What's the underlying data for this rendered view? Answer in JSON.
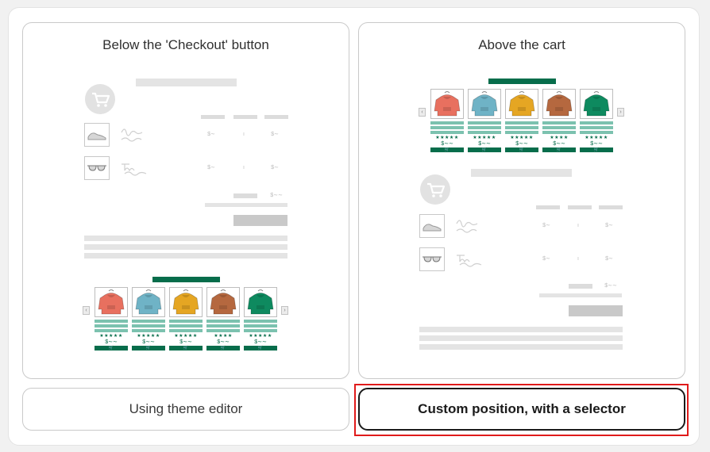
{
  "cards": {
    "below_checkout": {
      "title": "Below the 'Checkout' button"
    },
    "above_cart": {
      "title": "Above the cart"
    }
  },
  "options": {
    "theme_editor": "Using theme editor",
    "custom_selector": "Custom position, with a selector"
  },
  "preview": {
    "star_full": "★★★★★",
    "star_four": "★★★★",
    "price": "$∼∼",
    "price_glyph": "$∼",
    "qty_glyph": "ı",
    "buy_glyph": "🛒",
    "arrow_left": "‹",
    "arrow_right": "›",
    "colors": {
      "accent": "#076d4b",
      "accent_light": "#7cc2af",
      "selected_outline": "#e01b1b"
    },
    "hoodie_colors": [
      "#e8705f",
      "#6fb3c6",
      "#e5a623",
      "#b5683f",
      "#0e8a5f"
    ]
  }
}
